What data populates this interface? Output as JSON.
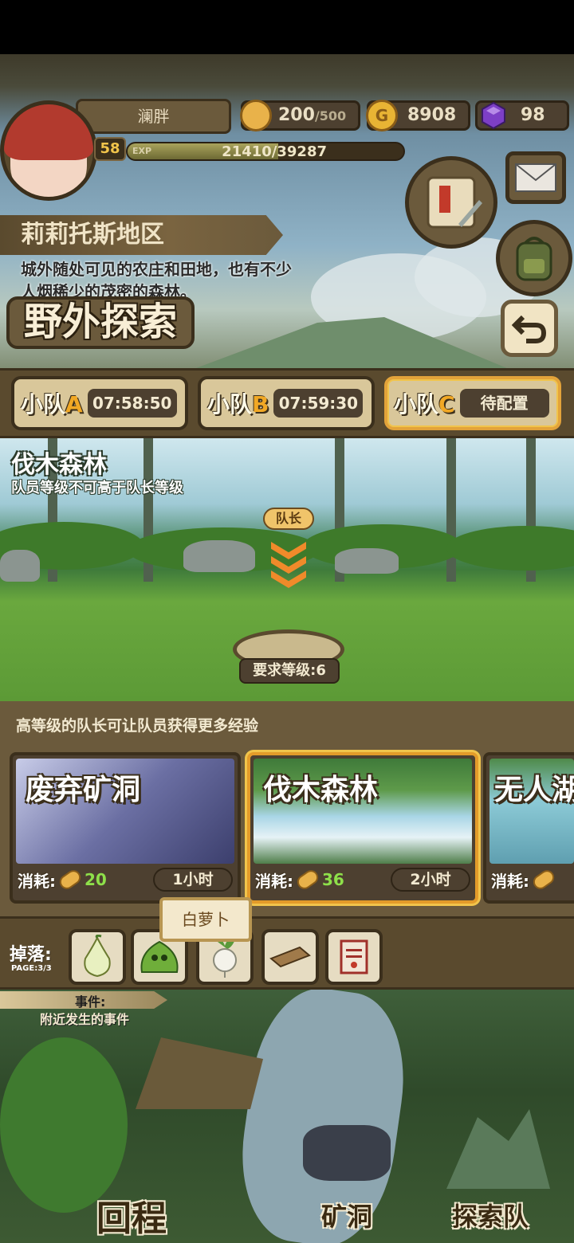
{
  "player": {
    "name": "澜胖",
    "level": "58",
    "exp_label": "EXP",
    "exp_text": "21410/39287",
    "exp_fraction": 0.545
  },
  "resources": {
    "stamina_value": "200",
    "stamina_max": "/500",
    "gold_icon": "G",
    "gold": "8908",
    "gems": "98"
  },
  "region": {
    "name": "莉莉托斯地区",
    "description": "城外随处可见的农庄和田地，也有不少人烟稀少的茂密的森林。"
  },
  "page_title": "野外探索",
  "teams": [
    {
      "prefix": "小队",
      "letter": "A",
      "status": "07:58:50"
    },
    {
      "prefix": "小队",
      "letter": "B",
      "status": "07:59:30"
    },
    {
      "prefix": "小队",
      "letter": "C",
      "status": "待配置"
    }
  ],
  "current_area": {
    "title": "伐木森林",
    "note": "队员等级不可高于队长等级",
    "leader_tag": "队长",
    "required_level": "要求等级:6"
  },
  "hint": "高等级的队长可让队员获得更多经验",
  "locations": [
    {
      "name": "废弃矿洞",
      "cost_label": "消耗:",
      "cost": "20",
      "duration": "1小时"
    },
    {
      "name": "伐木森林",
      "cost_label": "消耗:",
      "cost": "36",
      "duration": "2小时"
    },
    {
      "name": "无人湖",
      "cost_label": "消耗:",
      "cost": "",
      "duration": ""
    }
  ],
  "tooltip": "白萝卜",
  "drops": {
    "label": "掉落:",
    "page": "PAGE:3/3",
    "items": [
      "bulb-seed-icon",
      "green-slime-icon",
      "white-radish-icon",
      "wood-plank-icon",
      "scroll-icon"
    ]
  },
  "events": {
    "title": "事件:",
    "subtitle": "附近发生的事件"
  },
  "bottom_nav": {
    "return": "回程",
    "mine": "矿洞",
    "explore": "探索队"
  },
  "colors": {
    "accent_orange": "#f1a825",
    "wood": "#6b5a3c",
    "cost_green": "#8ee04a"
  }
}
